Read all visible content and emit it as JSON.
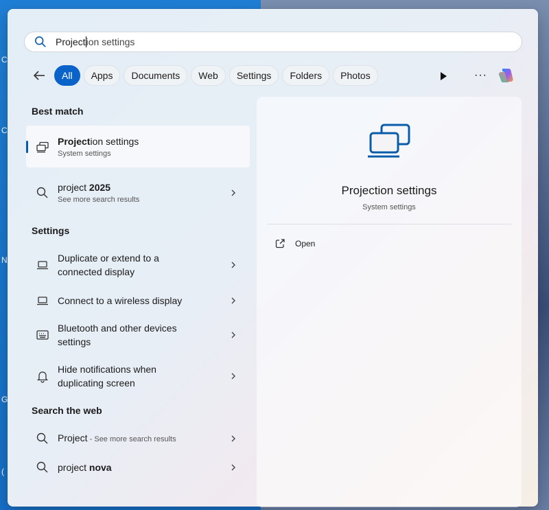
{
  "search": {
    "value_typed": "Project",
    "value_suggested": "ion settings"
  },
  "filters": {
    "chips": [
      "All",
      "Apps",
      "Documents",
      "Web",
      "Settings",
      "Folders",
      "Photos"
    ],
    "more_label": "···"
  },
  "best_match": {
    "heading": "Best match",
    "item": {
      "title_bold": "Project",
      "title_rest": "ion settings",
      "subtitle": "System settings"
    }
  },
  "project_search": {
    "title_normal": "project ",
    "title_bold": "2025",
    "subtitle": "See more search results"
  },
  "settings": {
    "heading": "Settings",
    "items": [
      {
        "line1": "Duplicate or extend to a",
        "line2": "connected display"
      },
      {
        "line1": "Connect to a wireless display",
        "line2": ""
      },
      {
        "line1": "Bluetooth and other devices",
        "line2": "settings"
      },
      {
        "line1": "Hide notifications when",
        "line2": "duplicating screen"
      }
    ]
  },
  "web": {
    "heading": "Search the web",
    "items": [
      {
        "title": "Project",
        "suffix": " - See more search results"
      },
      {
        "title_normal": "project ",
        "title_bold": "nova"
      }
    ]
  },
  "preview": {
    "title": "Projection settings",
    "subtitle": "System settings",
    "open_label": "Open"
  },
  "desktop_labels": [
    "C",
    "C",
    "N",
    "G",
    "("
  ]
}
